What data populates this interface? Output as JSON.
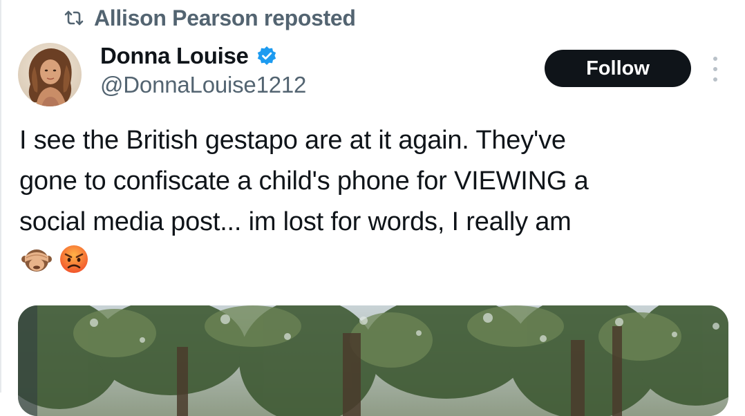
{
  "repost": {
    "icon": "repost-icon",
    "text": "Allison Pearson reposted"
  },
  "author": {
    "display_name": "Donna Louise",
    "handle": "@DonnaLouise1212",
    "verified": true,
    "verified_color": "#1d9bf0",
    "avatar_icon": "avatar-photo"
  },
  "follow_button": {
    "label": "Follow",
    "background": "#0f1419"
  },
  "more_menu": {
    "icon": "more-vertical-icon"
  },
  "tweet": {
    "text": "I see the British gestapo are at it again. They've\ngone to confiscate a child's phone for VIEWING a\nsocial media post... im lost for words, I really am",
    "emojis": [
      "see-no-evil-monkey-emoji",
      "angry-face-emoji"
    ]
  },
  "media": {
    "kind": "image",
    "description_icon": "trees-photo"
  },
  "colors": {
    "primary_text": "#0f1419",
    "secondary_text": "#536471",
    "accent": "#1d9bf0"
  }
}
